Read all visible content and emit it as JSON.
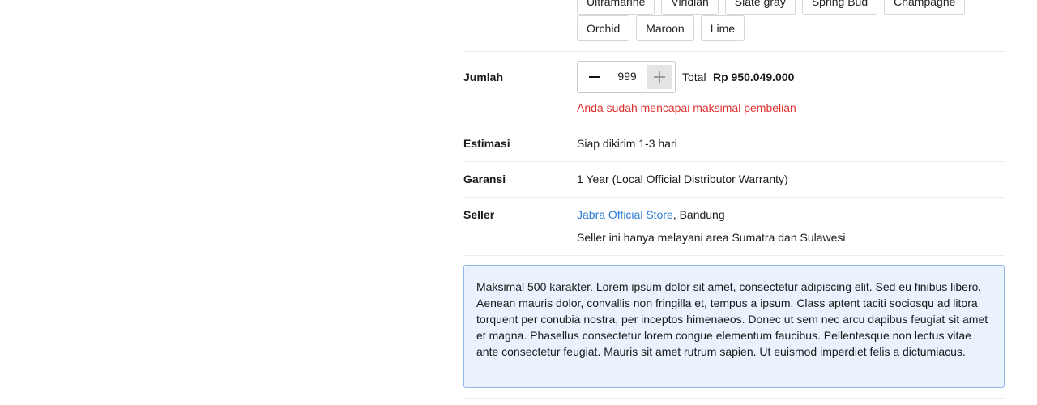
{
  "colors_row_top": [
    "Ultramarine",
    "Viridian",
    "Slate gray",
    "Spring Bud",
    "Champagne"
  ],
  "colors_row_second": [
    "Orchid",
    "Maroon",
    "Lime"
  ],
  "quantity": {
    "label": "Jumlah",
    "value": "999",
    "total_label": "Total",
    "total_value": "Rp 950.049.000",
    "error": "Anda sudah mencapai maksimal pembelian"
  },
  "estimasi": {
    "label": "Estimasi",
    "value": "Siap dikirim 1-3 hari"
  },
  "garansi": {
    "label": "Garansi",
    "value": "1 Year (Local Official Distributor Warranty)"
  },
  "seller": {
    "label": "Seller",
    "store_name": "Jabra Official Store",
    "location": ", Bandung",
    "note": "Seller ini hanya melayani area Sumatra dan Sulawesi"
  },
  "notice": "Maksimal 500 karakter. Lorem ipsum dolor sit amet, consectetur adipiscing elit. Sed eu finibus libero. Aenean mauris dolor, convallis non fringilla et, tempus a ipsum. Class aptent taciti sociosqu ad litora torquent per conubia nostra, per inceptos himenaeos. Donec ut sem nec arcu dapibus feugiat sit amet et magna. Phasellus consectetur lorem congue elementum faucibus. Pellentesque non lectus vitae ante consectetur feugiat. Mauris sit amet rutrum sapien. Ut euismod imperdiet felis a dictumiacus.",
  "theme": {
    "error_color": "#e03131",
    "link_color": "#2b7cd3",
    "notice_bg": "#eaf2fd",
    "notice_border": "#8db7ea"
  }
}
